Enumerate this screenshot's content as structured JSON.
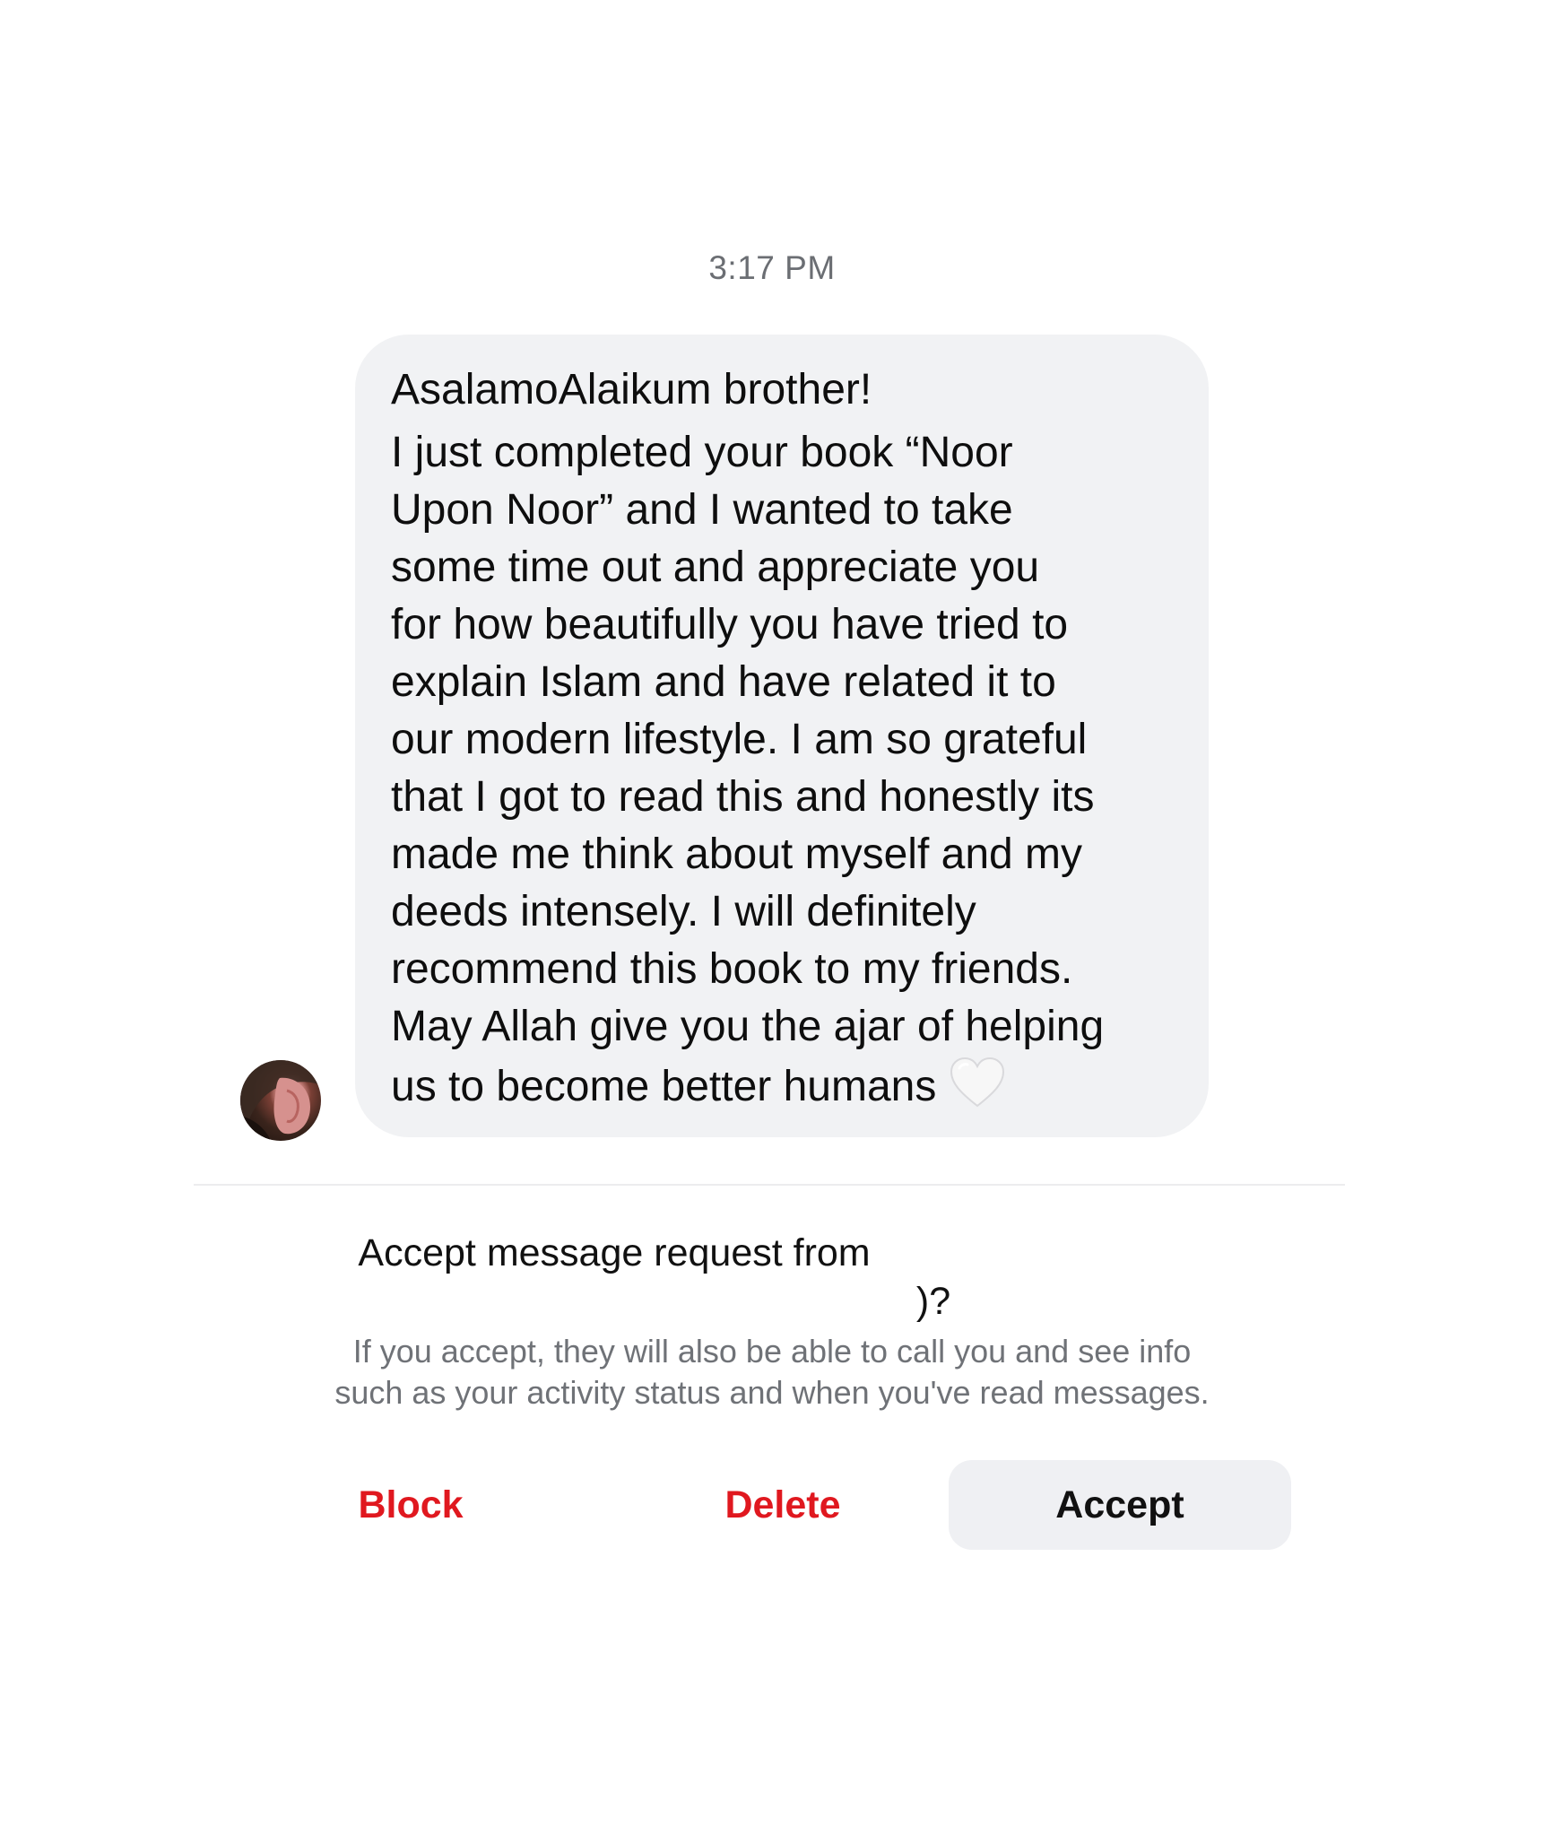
{
  "conversation": {
    "timestamp": "3:17 PM",
    "message": {
      "lines": [
        "AsalamoAlaikum brother!",
        "I just completed your book “Noor",
        "Upon Noor” and I wanted to take",
        "some time out and appreciate you",
        "for how beautifully you have tried to",
        "explain Islam and have related it to",
        "our modern lifestyle. I am so grateful",
        "that I got to read this and honestly its",
        "made me think about myself and my",
        "deeds intensely. I will definitely",
        "recommend this book to my friends.",
        "May Allah give you the ajar of helping",
        "us to become better humans"
      ],
      "emoji": "white-heart-icon"
    }
  },
  "request": {
    "title_prefix": "Accept message request from",
    "title_suffix": ")?",
    "description_line1": "If you accept, they will also be able to call you and see info",
    "description_line2": "such as your activity status and when you've read messages."
  },
  "actions": {
    "block_label": "Block",
    "delete_label": "Delete",
    "accept_label": "Accept"
  },
  "colors": {
    "destructive": "#e0181f",
    "bubble": "#f1f2f4",
    "secondary_text": "#6f7277"
  }
}
